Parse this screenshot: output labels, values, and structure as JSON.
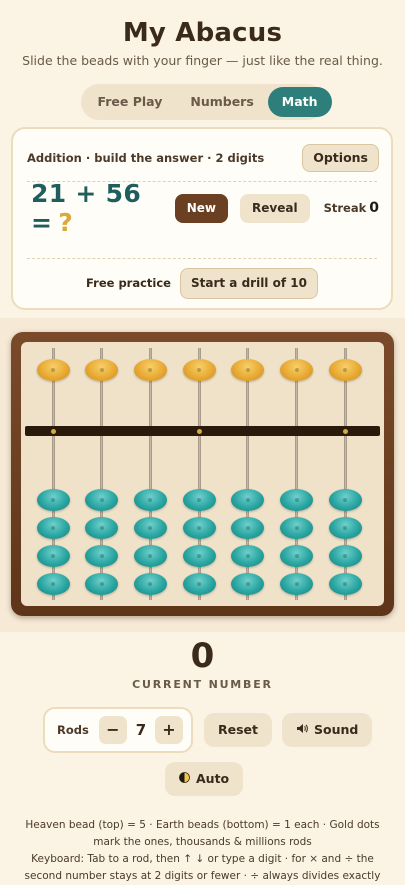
{
  "header": {
    "title": "My Abacus",
    "subtitle": "Slide the beads with your finger — just like the real thing."
  },
  "tabs": [
    {
      "label": "Free Play",
      "active": false
    },
    {
      "label": "Numbers",
      "active": false
    },
    {
      "label": "Math",
      "active": true
    }
  ],
  "card": {
    "mode_label": "Addition · build the answer · 2 digits",
    "options_label": "Options",
    "problem": "21 + 56 =",
    "problem_mark": "?",
    "new_label": "New",
    "reveal_label": "Reveal",
    "streak_label": "Streak",
    "streak_value": "0",
    "practice_label": "Free practice",
    "drill_label": "Start a drill of 10"
  },
  "abacus": {
    "rod_count": 7,
    "heaven_beads_per_rod": 1,
    "earth_beads_per_rod": 4,
    "gold_dot_rods": [
      1,
      4,
      7
    ],
    "heaven_color": "#e9aa33",
    "earth_color": "#2aa6a2",
    "frame_color": "#6b3f22"
  },
  "current": {
    "value": "0",
    "label": "CURRENT NUMBER"
  },
  "controls": {
    "rods_label": "Rods",
    "minus_label": "−",
    "rods_value": "7",
    "plus_label": "+",
    "reset_label": "Reset",
    "sound_icon": "speaker-icon",
    "sound_label": "Sound",
    "auto_icon": "half-moon-icon",
    "auto_label": "Auto"
  },
  "footer": {
    "line1": "Heaven bead (top) = 5 · Earth beads (bottom) = 1 each · Gold dots mark the ones, thousands & millions rods",
    "line2": "Keyboard: Tab to a rod, then ↑ ↓ or type a digit · for × and ÷ the second number stays at 2 digits or fewer · ÷ always divides exactly"
  },
  "colors": {
    "accent": "#2e7f7b",
    "brown": "#6b3f22",
    "gold": "#d9a93a",
    "background": "#fbf3e3"
  }
}
